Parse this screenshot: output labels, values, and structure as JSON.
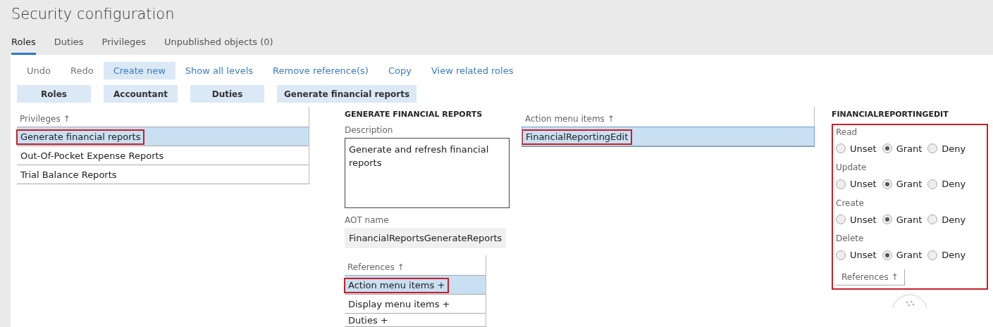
{
  "window": {
    "title": "Security configuration"
  },
  "tabs": [
    {
      "label": "Roles",
      "selected": true
    },
    {
      "label": "Duties",
      "selected": false
    },
    {
      "label": "Privileges",
      "selected": false
    },
    {
      "label": "Unpublished objects (0)",
      "selected": false
    }
  ],
  "toolbar": [
    {
      "label": "Undo",
      "disabled": true,
      "selected": false
    },
    {
      "label": "Redo",
      "disabled": true,
      "selected": false
    },
    {
      "label": "Create new",
      "disabled": false,
      "selected": true
    },
    {
      "label": "Show all levels",
      "disabled": false,
      "selected": false
    },
    {
      "label": "Remove reference(s)",
      "disabled": false,
      "selected": false
    },
    {
      "label": "Copy",
      "disabled": false,
      "selected": false
    },
    {
      "label": "View related roles",
      "disabled": false,
      "selected": false
    }
  ],
  "breadcrumbs": [
    "Roles",
    "Accountant",
    "Duties",
    "Generate financial reports"
  ],
  "privileges": {
    "header": "Privileges",
    "sort": "↑",
    "items": [
      {
        "label": "Generate financial reports",
        "selected": true,
        "highlighted": true
      },
      {
        "label": "Out-Of-Pocket Expense Reports",
        "selected": false,
        "highlighted": false
      },
      {
        "label": "Trial Balance Reports",
        "selected": false,
        "highlighted": false
      }
    ]
  },
  "details": {
    "heading": "GENERATE FINANCIAL REPORTS",
    "description_label": "Description",
    "description": "Generate and refresh financial reports",
    "aot_label": "AOT name",
    "aot_name": "FinancialReportsGenerateReports",
    "references": {
      "header": "References",
      "sort": "↑",
      "items": [
        {
          "label": "Action menu items +",
          "selected": true,
          "highlighted": true
        },
        {
          "label": "Display menu items +",
          "selected": false,
          "highlighted": false
        },
        {
          "label": "Duties +",
          "selected": false,
          "highlighted": false
        }
      ]
    }
  },
  "action_menu_items": {
    "header": "Action menu items",
    "sort": "↑",
    "items": [
      {
        "label": "FinancialReportingEdit",
        "selected": true,
        "highlighted": true
      }
    ]
  },
  "permissions": {
    "heading": "FINANCIALREPORTINGEDIT",
    "highlighted": true,
    "groups": [
      {
        "label": "Read",
        "options": [
          {
            "label": "Unset",
            "selected": false
          },
          {
            "label": "Grant",
            "selected": true
          },
          {
            "label": "Deny",
            "selected": false
          }
        ]
      },
      {
        "label": "Update",
        "options": [
          {
            "label": "Unset",
            "selected": false
          },
          {
            "label": "Grant",
            "selected": true
          },
          {
            "label": "Deny",
            "selected": false
          }
        ]
      },
      {
        "label": "Create",
        "options": [
          {
            "label": "Unset",
            "selected": false
          },
          {
            "label": "Grant",
            "selected": true
          },
          {
            "label": "Deny",
            "selected": false
          }
        ]
      },
      {
        "label": "Delete",
        "options": [
          {
            "label": "Unset",
            "selected": false
          },
          {
            "label": "Grant",
            "selected": true
          },
          {
            "label": "Deny",
            "selected": false
          }
        ]
      }
    ],
    "references": {
      "label": "References",
      "sort": "↑"
    }
  }
}
